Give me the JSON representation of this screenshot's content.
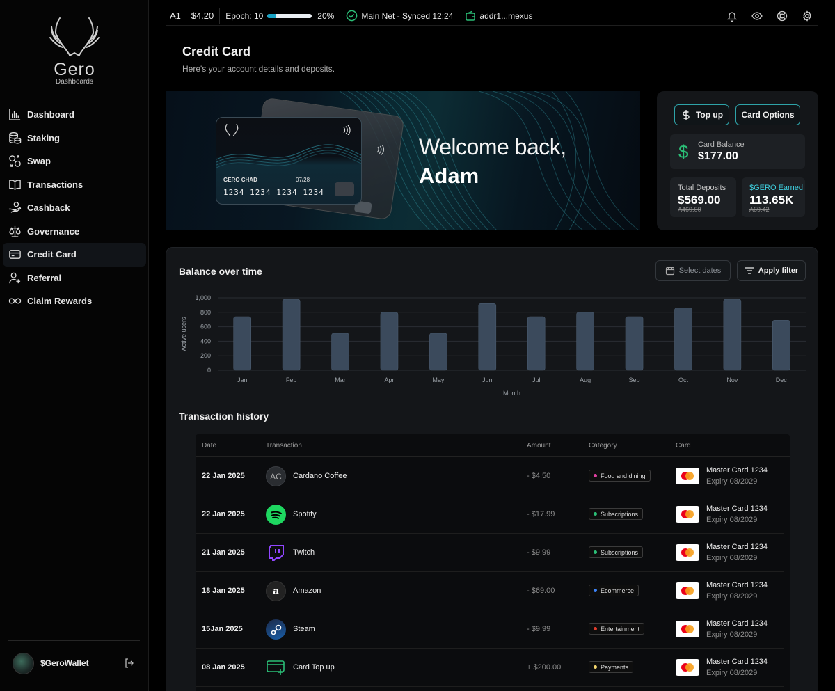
{
  "brand": {
    "name": "Gero",
    "sub": "Dashboards"
  },
  "sidebar": {
    "items": [
      {
        "label": "Dashboard",
        "icon": "bar-chart-icon"
      },
      {
        "label": "Staking",
        "icon": "coins-icon"
      },
      {
        "label": "Swap",
        "icon": "swap-icon"
      },
      {
        "label": "Transactions",
        "icon": "book-icon"
      },
      {
        "label": "Cashback",
        "icon": "hand-coin-icon"
      },
      {
        "label": "Governance",
        "icon": "scale-icon"
      },
      {
        "label": "Credit Card",
        "icon": "credit-card-icon",
        "active": true
      },
      {
        "label": "Referral",
        "icon": "user-plus-icon"
      },
      {
        "label": "Claim Rewards",
        "icon": "infinity-icon"
      }
    ],
    "wallet_name": "$GeroWallet"
  },
  "topbar": {
    "price": "₳1 = $4.20",
    "epoch_label": "Epoch: 10",
    "epoch_progress": 0.2,
    "epoch_percent": "20%",
    "network": "Main Net - Synced 12:24",
    "address": "addr1...mexus"
  },
  "header": {
    "title": "Credit Card",
    "subtitle": "Here's your account details and deposits."
  },
  "hero": {
    "welcome": "Welcome back,",
    "name": "Adam",
    "card_holder": "GERO CHAD",
    "card_expiry": "07/28",
    "card_number": "1234 1234 1234 1234"
  },
  "balance_panel": {
    "topup_label": "Top up",
    "options_label": "Card Options",
    "card_balance_label": "Card Balance",
    "card_balance_value": "$177.00",
    "total_deposits_label": "Total Deposits",
    "total_deposits_value": "$569.00",
    "total_deposits_sub": "₳469.00",
    "gero_earned_label": "$GERO Earned",
    "gero_earned_value": "113.65K",
    "gero_earned_sub": "₳69.42"
  },
  "chart_section": {
    "title": "Balance over time",
    "select_dates_label": "Select dates",
    "apply_filter_label": "Apply filter"
  },
  "chart_data": {
    "type": "bar",
    "categories": [
      "Jan",
      "Feb",
      "Mar",
      "Apr",
      "May",
      "Jun",
      "Jul",
      "Aug",
      "Sep",
      "Oct",
      "Nov",
      "Dec"
    ],
    "values": [
      740,
      980,
      510,
      800,
      510,
      920,
      740,
      800,
      740,
      860,
      980,
      690
    ],
    "xlabel": "Month",
    "ylabel": "Active users",
    "ylim": [
      0,
      1000
    ],
    "yticks": [
      "0",
      "200",
      "400",
      "600",
      "800",
      "1,000"
    ],
    "grid": true,
    "color": "#3b4a5c"
  },
  "transactions": {
    "title": "Transaction history",
    "columns": [
      "Date",
      "Transaction",
      "Amount",
      "Category",
      "Card"
    ],
    "rows": [
      {
        "date": "22 Jan 2025",
        "name": "Cardano Coffee",
        "logo": "AC",
        "logo_icon": "initials-avatar",
        "amount": "- $4.50",
        "category": "Food and dining",
        "cat_color": "#e040a0",
        "card": "Master Card 1234",
        "expiry": "Expiry 08/2029"
      },
      {
        "date": "22 Jan 2025",
        "name": "Spotify",
        "logo_icon": "spotify-icon",
        "amount": "- $17.99",
        "category": "Subscriptions",
        "cat_color": "#2bbf77",
        "card": "Master Card 1234",
        "expiry": "Expiry 08/2029"
      },
      {
        "date": "21 Jan 2025",
        "name": "Twitch",
        "logo_icon": "twitch-icon",
        "amount": "- $9.99",
        "category": "Subscriptions",
        "cat_color": "#2bbf77",
        "card": "Master Card 1234",
        "expiry": "Expiry 08/2029"
      },
      {
        "date": "18 Jan 2025",
        "name": "Amazon",
        "logo_icon": "amazon-icon",
        "amount": "- $69.00",
        "category": "Ecommerce",
        "cat_color": "#3b82f6",
        "card": "Master Card 1234",
        "expiry": "Expiry 08/2029"
      },
      {
        "date": "15Jan 2025",
        "name": "Steam",
        "logo_icon": "steam-icon",
        "amount": "- $9.99",
        "category": "Entertainment",
        "cat_color": "#e03b2b",
        "card": "Master Card 1234",
        "expiry": "Expiry 08/2029"
      },
      {
        "date": "08 Jan 2025",
        "name": "Card Top up",
        "logo_icon": "card-add-icon",
        "amount": "+ $200.00",
        "category": "Payments",
        "cat_color": "#f5d76e",
        "card": "Master Card 1234",
        "expiry": "Expiry 08/2029"
      }
    ]
  }
}
